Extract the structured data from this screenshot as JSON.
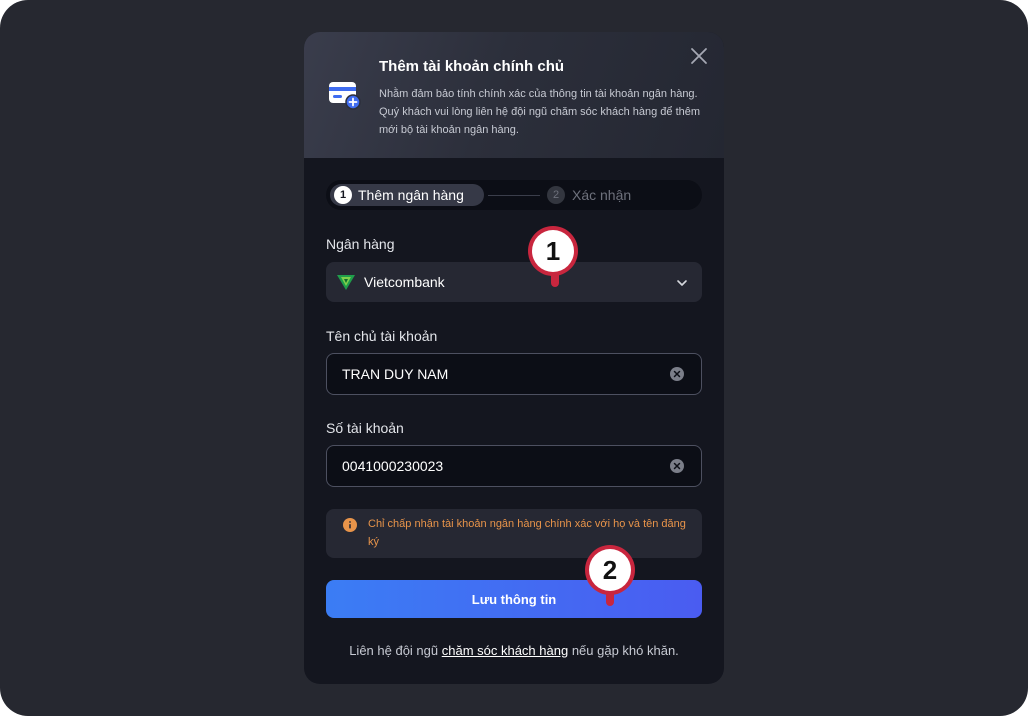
{
  "modal": {
    "title": "Thêm tài khoản chính chủ",
    "description": "Nhằm đảm bảo tính chính xác của thông tin tài khoản ngân hàng. Quý khách vui lòng liên hệ đội ngũ chăm sóc khách hàng để thêm mới bộ tài khoản ngân hàng."
  },
  "stepper": {
    "steps": [
      {
        "number": "1",
        "label": "Thêm ngân hàng",
        "state": "active"
      },
      {
        "number": "2",
        "label": "Xác nhận",
        "state": "inactive"
      }
    ]
  },
  "form": {
    "bank": {
      "label": "Ngân hàng",
      "value": "Vietcombank",
      "logo_icon": "vietcombank-logo-icon"
    },
    "account_name": {
      "label": "Tên chủ tài khoản",
      "value": "TRAN DUY NAM"
    },
    "account_number": {
      "label": "Số tài khoản",
      "value": "0041000230023"
    },
    "warning": "Chỉ chấp nhận tài khoản ngân hàng chính xác với họ và tên đăng ký",
    "save_label": "Lưu thông tin"
  },
  "footer": {
    "prefix": "Liên hệ đội ngũ ",
    "link": "chăm sóc khách hàng",
    "suffix": " nếu gặp khó khăn."
  },
  "annotations": [
    {
      "label": "1"
    },
    {
      "label": "2"
    }
  ],
  "colors": {
    "background": "#262830",
    "modal": "#14161f",
    "accent_start": "#3b7df4",
    "accent_end": "#4a5cf1",
    "warning": "#e8944a",
    "marker_ring": "#c8263e"
  }
}
